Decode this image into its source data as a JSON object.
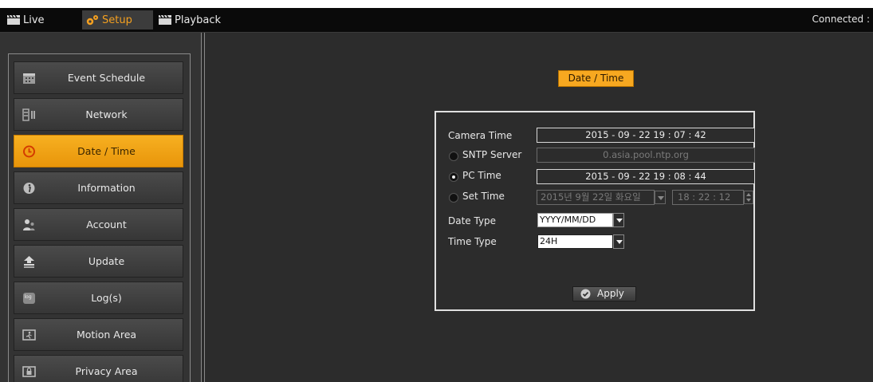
{
  "topbar": {
    "tabs": [
      {
        "label": "Live",
        "icon": "clapper-icon"
      },
      {
        "label": "Setup",
        "icon": "gear-icon"
      },
      {
        "label": "Playback",
        "icon": "clapper-icon"
      }
    ],
    "status": "Connected :"
  },
  "sidebar": {
    "items": [
      {
        "label": "Event Schedule",
        "icon": "calendar-icon"
      },
      {
        "label": "Network",
        "icon": "network-icon"
      },
      {
        "label": "Date / Time",
        "icon": "clock-icon",
        "active": true
      },
      {
        "label": "Information",
        "icon": "info-icon"
      },
      {
        "label": "Account",
        "icon": "users-icon"
      },
      {
        "label": "Update",
        "icon": "upload-icon"
      },
      {
        "label": "Log(s)",
        "icon": "log-icon"
      },
      {
        "label": "Motion Area",
        "icon": "motion-icon"
      },
      {
        "label": "Privacy Area",
        "icon": "lock-icon"
      }
    ]
  },
  "main": {
    "title": "Date / Time",
    "camera_time": {
      "label": "Camera Time",
      "value": "2015 - 09 - 22  19 : 07 : 42"
    },
    "sntp": {
      "label": "SNTP Server",
      "value": "0.asia.pool.ntp.org",
      "selected": false
    },
    "pc_time": {
      "label": "PC Time",
      "value": "2015 - 09 - 22  19 : 08 : 44",
      "selected": true
    },
    "set_time": {
      "label": "Set Time",
      "date_value": "2015년 9월 22일 화요일",
      "time_value": "18 : 22 : 12",
      "selected": false
    },
    "date_type": {
      "label": "Date Type",
      "value": "YYYY/MM/DD"
    },
    "time_type": {
      "label": "Time Type",
      "value": "24H"
    },
    "apply_label": "Apply"
  },
  "colors": {
    "accent": "#f7a820",
    "background": "#2c2c2c",
    "topbar": "#0a0a0a"
  }
}
